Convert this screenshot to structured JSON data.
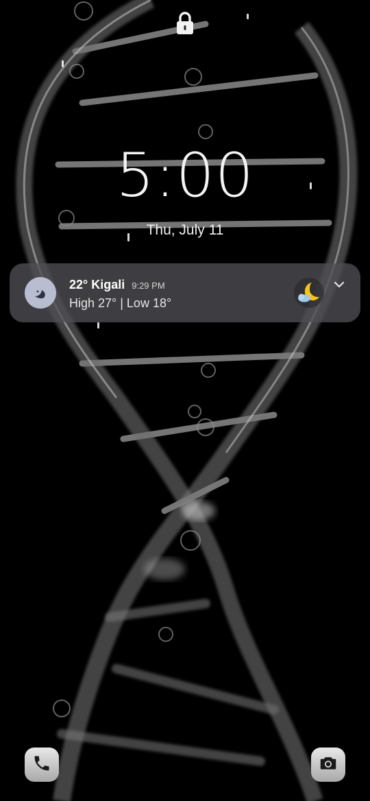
{
  "lock_screen": {
    "lock_icon": "lock-icon",
    "time": "5:00",
    "date": "Thu, July 11"
  },
  "notification": {
    "app_icon": "moon-icon",
    "title": "22° Kigali",
    "time": "9:29 PM",
    "body": "High 27° | Low 18°",
    "weather_icon": "crescent-moon-cloud-icon",
    "expand_icon": "chevron-down-icon"
  },
  "shortcuts": {
    "left": "phone-icon",
    "right": "camera-icon"
  },
  "colors": {
    "background": "#000000",
    "notification_bg": "#505054",
    "app_icon_bg": "#b9bdd0",
    "moon_yellow": "#f6c41c"
  }
}
